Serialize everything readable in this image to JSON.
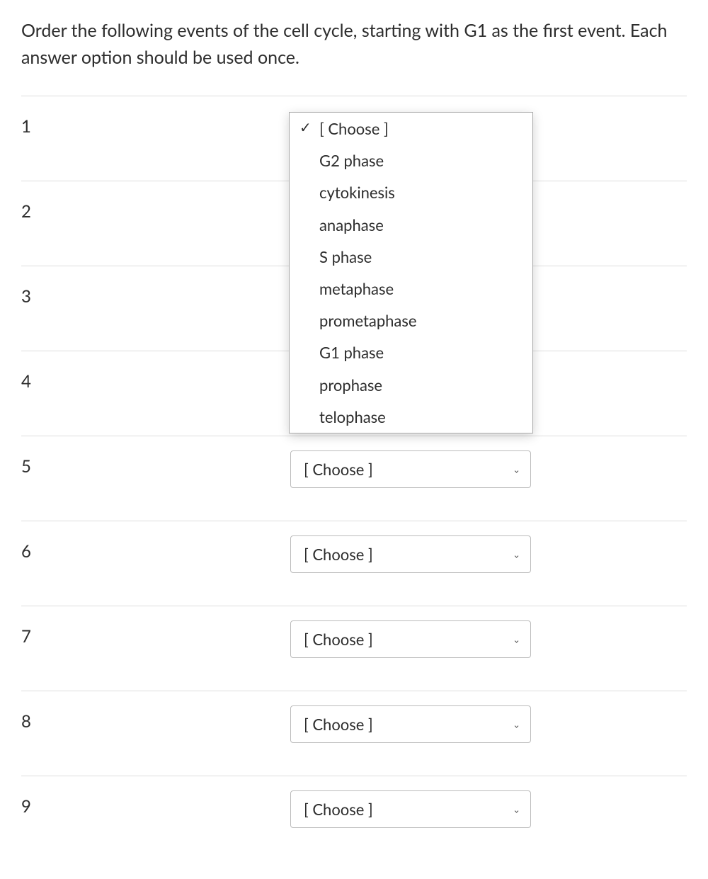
{
  "question": "Order the following events of the cell cycle, starting with G1 as the first event. Each answer option should be used once.",
  "placeholder": "[ Choose ]",
  "rows": [
    {
      "label": "1"
    },
    {
      "label": "2"
    },
    {
      "label": "3"
    },
    {
      "label": "4"
    },
    {
      "label": "5"
    },
    {
      "label": "6"
    },
    {
      "label": "7"
    },
    {
      "label": "8"
    },
    {
      "label": "9"
    }
  ],
  "dropdown": {
    "selected": "[ Choose ]",
    "options": [
      "G2 phase",
      "cytokinesis",
      "anaphase",
      "S phase",
      "metaphase",
      "prometaphase",
      "G1 phase",
      "prophase",
      "telophase"
    ]
  }
}
